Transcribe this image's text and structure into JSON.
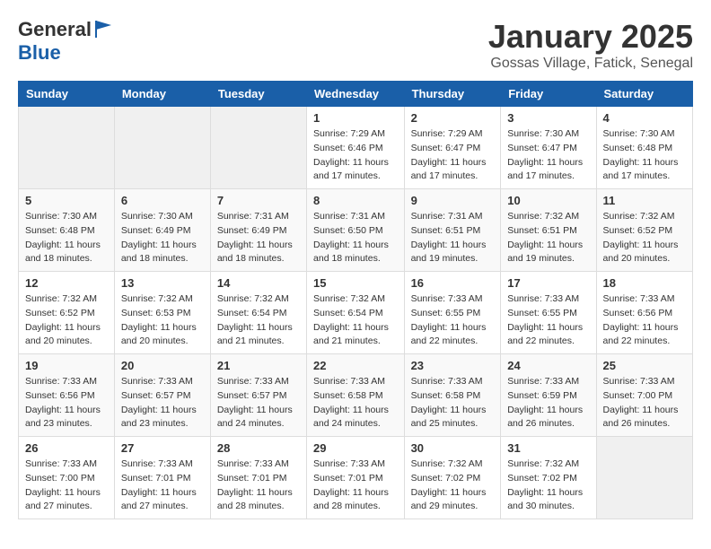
{
  "header": {
    "logo_general": "General",
    "logo_blue": "Blue",
    "month_title": "January 2025",
    "subtitle": "Gossas Village, Fatick, Senegal"
  },
  "weekdays": [
    "Sunday",
    "Monday",
    "Tuesday",
    "Wednesday",
    "Thursday",
    "Friday",
    "Saturday"
  ],
  "weeks": [
    [
      null,
      null,
      null,
      {
        "day": 1,
        "sunrise": "7:29 AM",
        "sunset": "6:46 PM",
        "daylight": "11 hours and 17 minutes."
      },
      {
        "day": 2,
        "sunrise": "7:29 AM",
        "sunset": "6:47 PM",
        "daylight": "11 hours and 17 minutes."
      },
      {
        "day": 3,
        "sunrise": "7:30 AM",
        "sunset": "6:47 PM",
        "daylight": "11 hours and 17 minutes."
      },
      {
        "day": 4,
        "sunrise": "7:30 AM",
        "sunset": "6:48 PM",
        "daylight": "11 hours and 17 minutes."
      }
    ],
    [
      {
        "day": 5,
        "sunrise": "7:30 AM",
        "sunset": "6:48 PM",
        "daylight": "11 hours and 18 minutes."
      },
      {
        "day": 6,
        "sunrise": "7:30 AM",
        "sunset": "6:49 PM",
        "daylight": "11 hours and 18 minutes."
      },
      {
        "day": 7,
        "sunrise": "7:31 AM",
        "sunset": "6:49 PM",
        "daylight": "11 hours and 18 minutes."
      },
      {
        "day": 8,
        "sunrise": "7:31 AM",
        "sunset": "6:50 PM",
        "daylight": "11 hours and 18 minutes."
      },
      {
        "day": 9,
        "sunrise": "7:31 AM",
        "sunset": "6:51 PM",
        "daylight": "11 hours and 19 minutes."
      },
      {
        "day": 10,
        "sunrise": "7:32 AM",
        "sunset": "6:51 PM",
        "daylight": "11 hours and 19 minutes."
      },
      {
        "day": 11,
        "sunrise": "7:32 AM",
        "sunset": "6:52 PM",
        "daylight": "11 hours and 20 minutes."
      }
    ],
    [
      {
        "day": 12,
        "sunrise": "7:32 AM",
        "sunset": "6:52 PM",
        "daylight": "11 hours and 20 minutes."
      },
      {
        "day": 13,
        "sunrise": "7:32 AM",
        "sunset": "6:53 PM",
        "daylight": "11 hours and 20 minutes."
      },
      {
        "day": 14,
        "sunrise": "7:32 AM",
        "sunset": "6:54 PM",
        "daylight": "11 hours and 21 minutes."
      },
      {
        "day": 15,
        "sunrise": "7:32 AM",
        "sunset": "6:54 PM",
        "daylight": "11 hours and 21 minutes."
      },
      {
        "day": 16,
        "sunrise": "7:33 AM",
        "sunset": "6:55 PM",
        "daylight": "11 hours and 22 minutes."
      },
      {
        "day": 17,
        "sunrise": "7:33 AM",
        "sunset": "6:55 PM",
        "daylight": "11 hours and 22 minutes."
      },
      {
        "day": 18,
        "sunrise": "7:33 AM",
        "sunset": "6:56 PM",
        "daylight": "11 hours and 22 minutes."
      }
    ],
    [
      {
        "day": 19,
        "sunrise": "7:33 AM",
        "sunset": "6:56 PM",
        "daylight": "11 hours and 23 minutes."
      },
      {
        "day": 20,
        "sunrise": "7:33 AM",
        "sunset": "6:57 PM",
        "daylight": "11 hours and 23 minutes."
      },
      {
        "day": 21,
        "sunrise": "7:33 AM",
        "sunset": "6:57 PM",
        "daylight": "11 hours and 24 minutes."
      },
      {
        "day": 22,
        "sunrise": "7:33 AM",
        "sunset": "6:58 PM",
        "daylight": "11 hours and 24 minutes."
      },
      {
        "day": 23,
        "sunrise": "7:33 AM",
        "sunset": "6:58 PM",
        "daylight": "11 hours and 25 minutes."
      },
      {
        "day": 24,
        "sunrise": "7:33 AM",
        "sunset": "6:59 PM",
        "daylight": "11 hours and 26 minutes."
      },
      {
        "day": 25,
        "sunrise": "7:33 AM",
        "sunset": "7:00 PM",
        "daylight": "11 hours and 26 minutes."
      }
    ],
    [
      {
        "day": 26,
        "sunrise": "7:33 AM",
        "sunset": "7:00 PM",
        "daylight": "11 hours and 27 minutes."
      },
      {
        "day": 27,
        "sunrise": "7:33 AM",
        "sunset": "7:01 PM",
        "daylight": "11 hours and 27 minutes."
      },
      {
        "day": 28,
        "sunrise": "7:33 AM",
        "sunset": "7:01 PM",
        "daylight": "11 hours and 28 minutes."
      },
      {
        "day": 29,
        "sunrise": "7:33 AM",
        "sunset": "7:01 PM",
        "daylight": "11 hours and 28 minutes."
      },
      {
        "day": 30,
        "sunrise": "7:32 AM",
        "sunset": "7:02 PM",
        "daylight": "11 hours and 29 minutes."
      },
      {
        "day": 31,
        "sunrise": "7:32 AM",
        "sunset": "7:02 PM",
        "daylight": "11 hours and 30 minutes."
      },
      null
    ]
  ],
  "labels": {
    "sunrise": "Sunrise:",
    "sunset": "Sunset:",
    "daylight": "Daylight hours"
  }
}
